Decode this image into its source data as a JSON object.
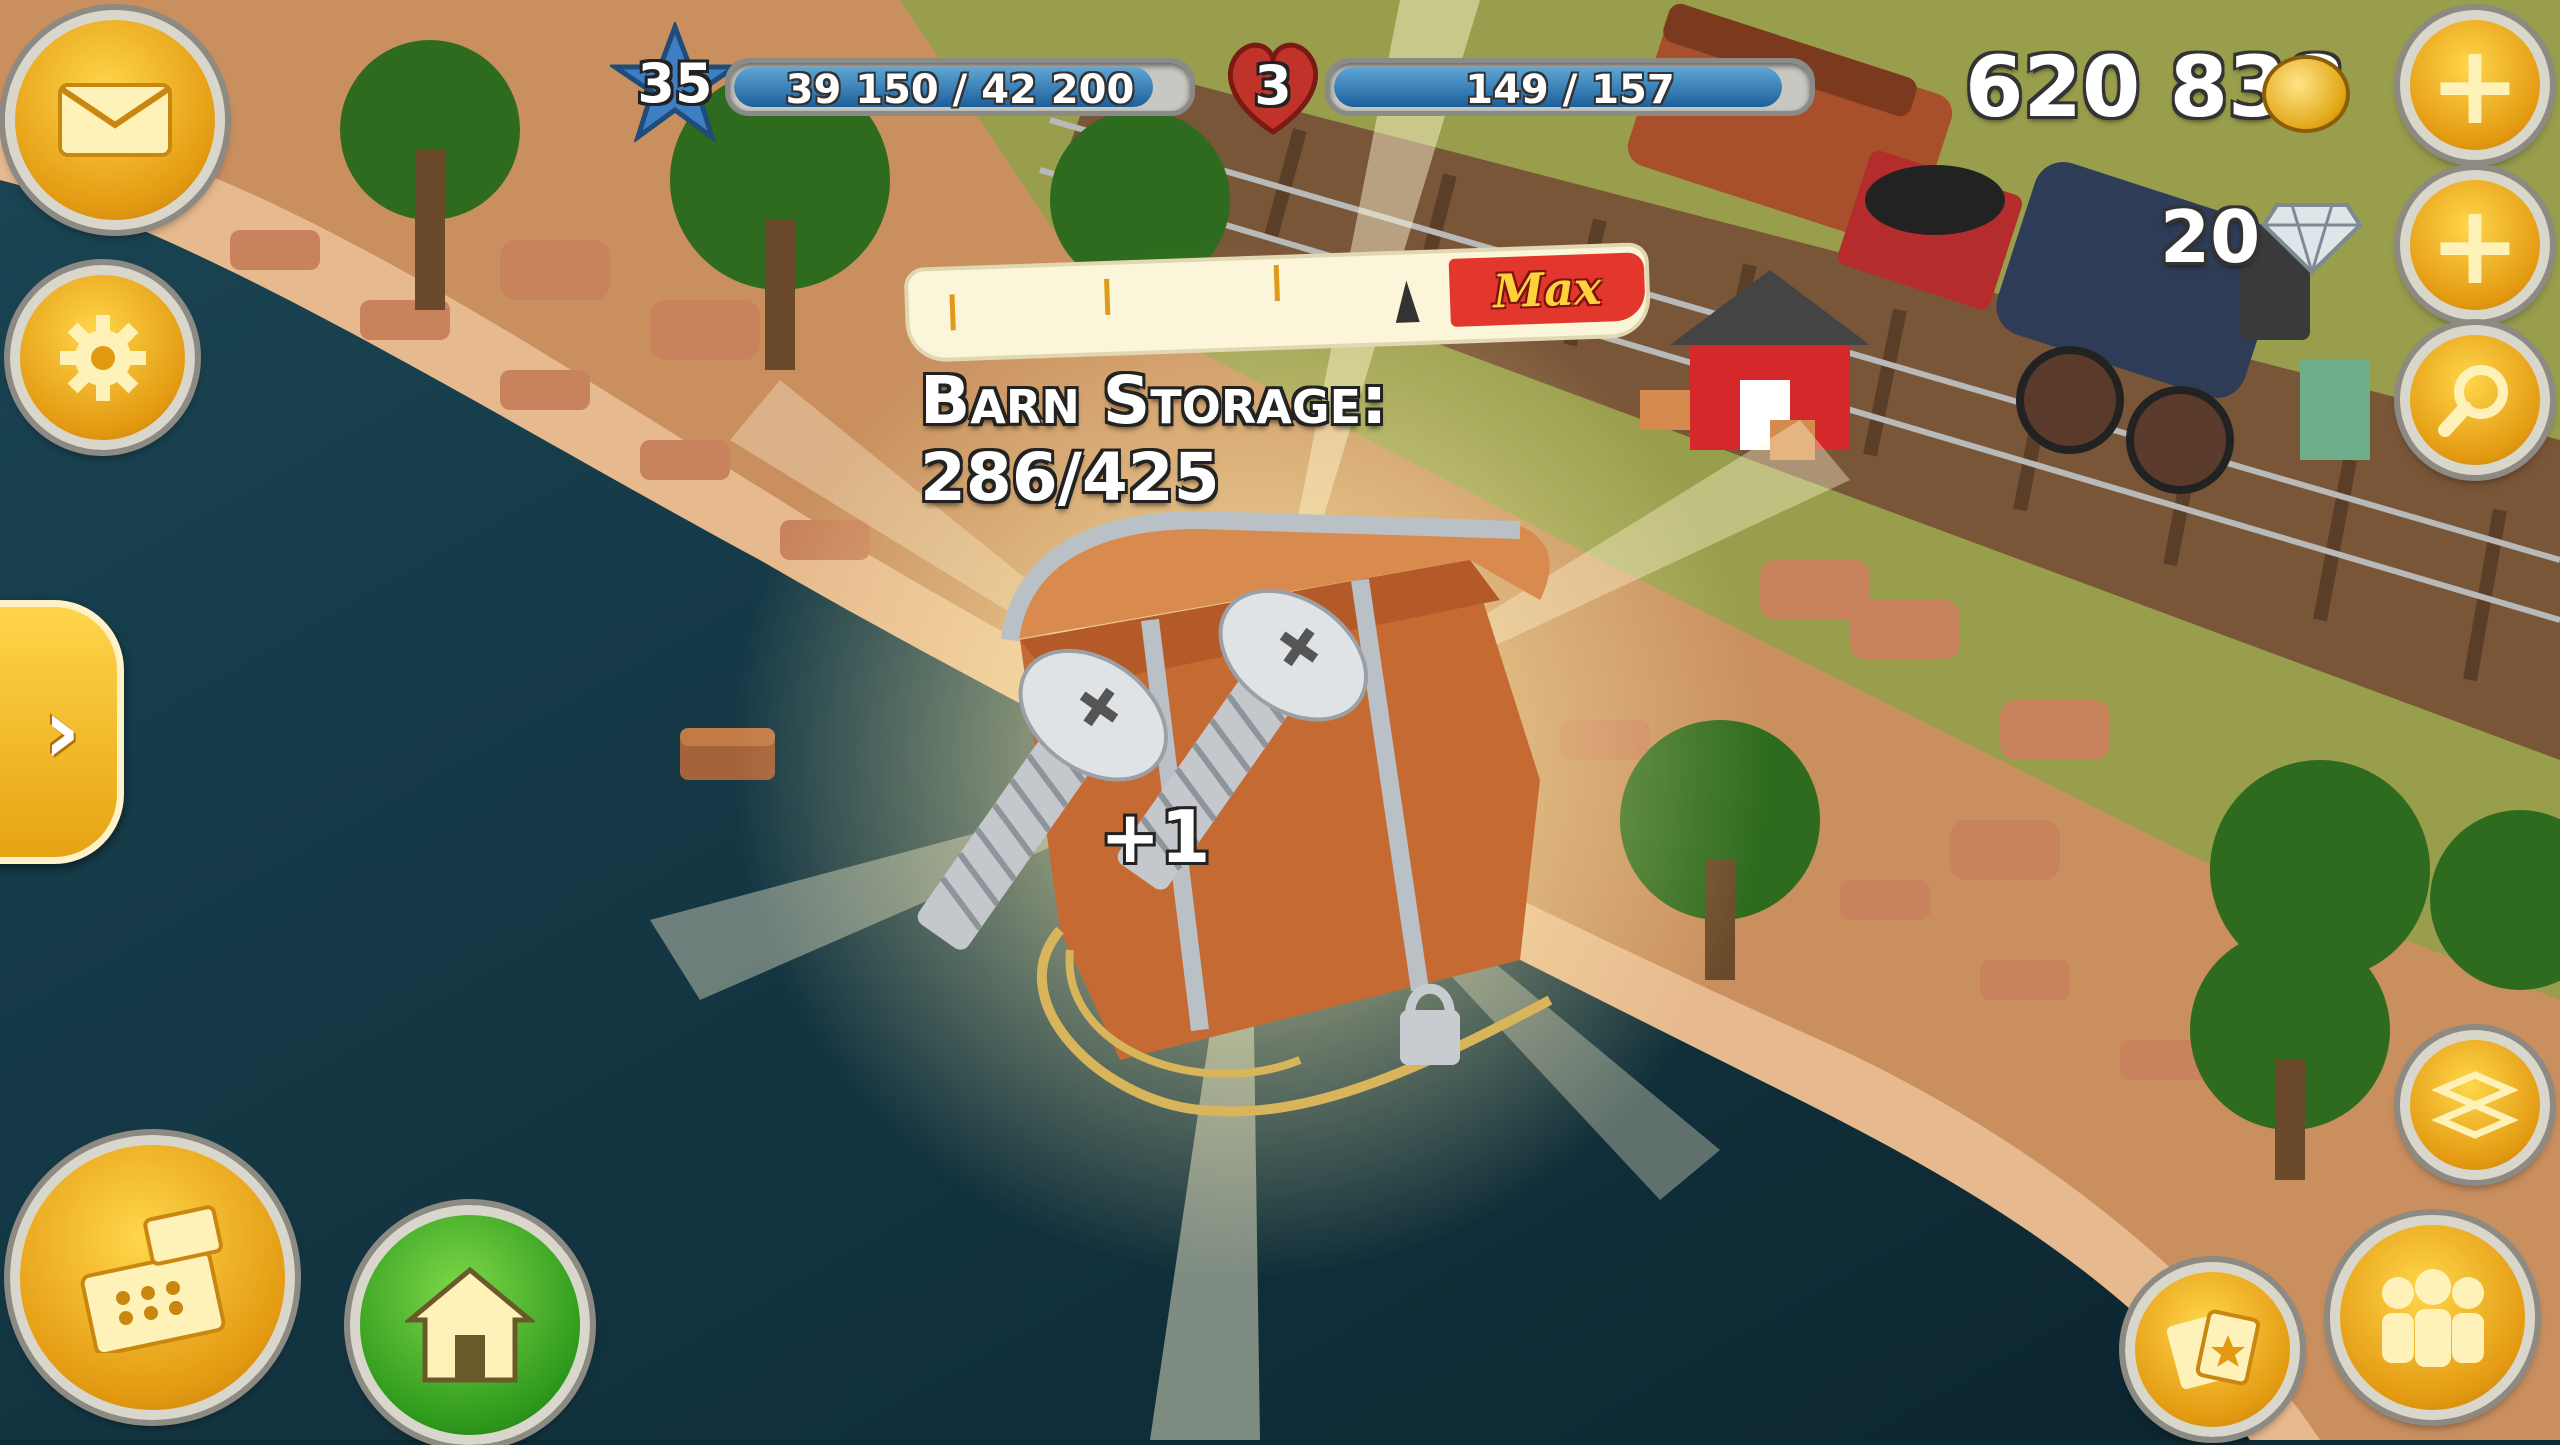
{
  "hud": {
    "level": "35",
    "xp_text": "39 150 / 42 200",
    "xp_progress": 0.928,
    "hearts": "3",
    "reputation_text": "149 / 157",
    "reputation_progress": 0.949,
    "coins": "620 838",
    "diamonds": "20"
  },
  "storage": {
    "max_label": "Max",
    "title": "Barn Storage: 286/425",
    "fill_fraction": 0.673
  },
  "reward": {
    "amount": "+1",
    "item_icon": "screw-icon",
    "container_icon": "treasure-chest-icon"
  },
  "buttons": {
    "mail": "mail-icon",
    "settings": "gear-icon",
    "expand": "chevron-right-icon",
    "shop": "cash-register-icon",
    "home": "house-icon",
    "add_coins": "plus-icon",
    "add_diamonds": "plus-icon",
    "search": "magnifier-icon",
    "edit_mode": "arrows-icon",
    "cards": "cards-icon",
    "friends": "people-icon"
  },
  "colors": {
    "accent_gold": "#f2b51e",
    "xp_bar": "#2f74b5",
    "heart_red": "#c0332a",
    "max_red": "#e3362c",
    "water": "#163a45",
    "sand": "#d9a77a"
  }
}
